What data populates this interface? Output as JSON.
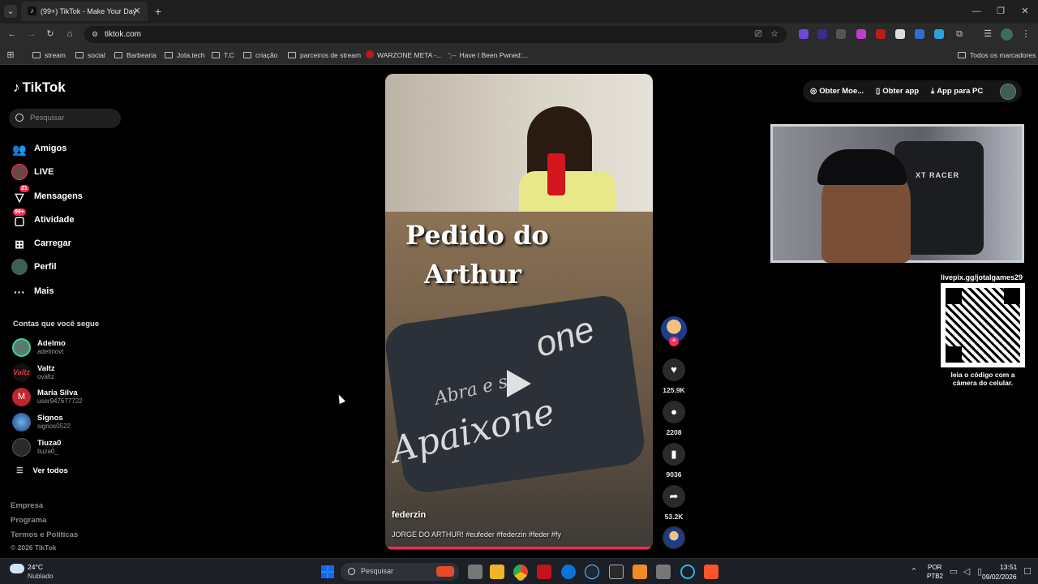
{
  "browser": {
    "tab_title": "(99+) TikTok - Make Your Day",
    "url": "tiktok.com",
    "bookmarks": [
      "stream",
      "social",
      "Barbearia",
      "Jota.tech",
      "T.C",
      "criação",
      "parceiros de stream",
      "WARZONE META -...",
      "Have I Been Pwned:..."
    ],
    "all_bookmarks": "Todos os marcadores"
  },
  "tiktok": {
    "logo": "TikTok",
    "search_placeholder": "Pesquisar",
    "nav": [
      {
        "label": "Amigos",
        "icon": "friends-icon"
      },
      {
        "label": "LIVE",
        "icon": "live-icon"
      },
      {
        "label": "Mensagens",
        "icon": "messages-icon",
        "badge": "21"
      },
      {
        "label": "Atividade",
        "icon": "activity-icon",
        "badge": "99+"
      },
      {
        "label": "Carregar",
        "icon": "upload-icon"
      },
      {
        "label": "Perfil",
        "icon": "profile-icon"
      },
      {
        "label": "Mais",
        "icon": "more-icon"
      }
    ],
    "following_title": "Contas que você segue",
    "following": [
      {
        "name": "Adelmo",
        "handle": "adelmovt"
      },
      {
        "name": "Valtz",
        "handle": "ovaltz"
      },
      {
        "name": "Maria Silva",
        "handle": "user947677722"
      },
      {
        "name": "Signos",
        "handle": "signos0522"
      },
      {
        "name": "Tiuza0",
        "handle": "tiuza0_"
      }
    ],
    "see_all": "Ver todos",
    "footer": [
      "Empresa",
      "Programa",
      "Termos e Políticas"
    ],
    "copyright": "© 2026 TikTok",
    "top_actions": {
      "coins": "Obter Moe...",
      "get_app": "Obter app",
      "pc_app": "App para PC"
    },
    "video": {
      "overlay_line1": "Pedido do",
      "overlay_line2": "Arthur",
      "box_text1": "Abra e s",
      "box_text2": "Apaixone",
      "box_text3": "one",
      "author": "federzin",
      "caption": "JORGE DO ARTHUR! #eufeder #federzin #feder #fy"
    },
    "stats": {
      "likes": "125.9K",
      "comments": "2208",
      "saves": "9036",
      "shares": "53.2K"
    }
  },
  "stream_overlay": {
    "qr_url": "livepix.gg/jotalgames29",
    "qr_caption": "leia o código com a câmera do celular.",
    "chair_brand": "XT RACER"
  },
  "taskbar": {
    "weather_temp": "24°C",
    "weather_desc": "Nublado",
    "search": "Pesquisar",
    "lang": "POR",
    "lang2": "PTB2",
    "time": "13:51",
    "date": "09/02/2026"
  },
  "colors": {
    "accent": "#fe2c55",
    "bg": "#000000",
    "chrome": "#2b2b2b"
  }
}
